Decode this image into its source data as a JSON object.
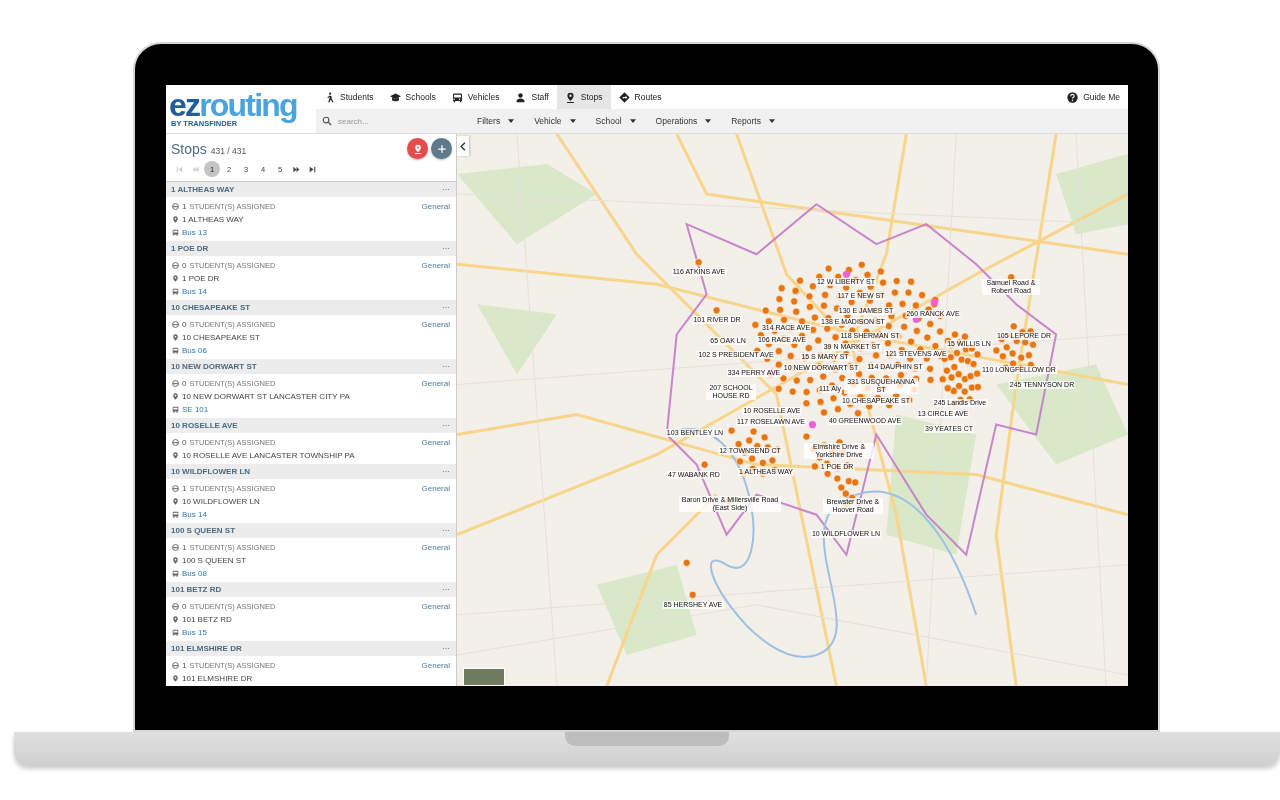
{
  "logo": {
    "part_1": "ez",
    "part_2": "routing",
    "tagline": "BY TRANSFINDER"
  },
  "tabs": [
    {
      "label": "Students",
      "selected": false
    },
    {
      "label": "Schools",
      "selected": false
    },
    {
      "label": "Vehicles",
      "selected": false
    },
    {
      "label": "Staff",
      "selected": false
    },
    {
      "label": "Stops",
      "selected": true
    },
    {
      "label": "Routes",
      "selected": false
    }
  ],
  "guide": {
    "label": "Guide Me"
  },
  "search": {
    "placeholder": "search..."
  },
  "menus": [
    "Filters",
    "Vehicle",
    "School",
    "Operations",
    "Reports"
  ],
  "panel": {
    "title": "Stops",
    "count": "431 / 431"
  },
  "pager": {
    "controls": [
      {
        "kind": "first",
        "disabled": true
      },
      {
        "kind": "prev",
        "disabled": true
      },
      {
        "kind": "next",
        "disabled": false
      },
      {
        "kind": "last",
        "disabled": false
      }
    ],
    "pages": [
      {
        "label": "1",
        "selected": true
      },
      {
        "label": "2",
        "selected": false
      },
      {
        "label": "3",
        "selected": false
      },
      {
        "label": "4",
        "selected": false
      },
      {
        "label": "5",
        "selected": false
      }
    ]
  },
  "stops": [
    {
      "name": "1 ALTHEAS WAY",
      "more": "···",
      "students": "1",
      "students_label": "STUDENT(S) ASSIGNED",
      "type": "General",
      "address": "1 ALTHEAS WAY",
      "bus": "Bus 13"
    },
    {
      "name": "1 POE DR",
      "more": "···",
      "students": "0",
      "students_label": "STUDENT(S) ASSIGNED",
      "type": "General",
      "address": "1 POE DR",
      "bus": "Bus 14"
    },
    {
      "name": "10 CHESAPEAKE ST",
      "more": "···",
      "students": "0",
      "students_label": "STUDENT(S) ASSIGNED",
      "type": "General",
      "address": "10 CHESAPEAKE ST",
      "bus": "Bus 06"
    },
    {
      "name": "10 NEW DORWART ST",
      "more": "···",
      "students": "0",
      "students_label": "STUDENT(S) ASSIGNED",
      "type": "General",
      "address": "10 NEW DORWART ST LANCASTER CITY PA",
      "bus": "SE 101"
    },
    {
      "name": "10 ROSELLE AVE",
      "more": "···",
      "students": "0",
      "students_label": "STUDENT(S) ASSIGNED",
      "type": "General",
      "address": "10 ROSELLE AVE LANCASTER TOWNSHIP PA"
    },
    {
      "name": "10 WILDFLOWER LN",
      "more": "···",
      "students": "1",
      "students_label": "STUDENT(S) ASSIGNED",
      "type": "General",
      "address": "10 WILDFLOWER LN",
      "bus": "Bus 14"
    },
    {
      "name": "100 S QUEEN ST",
      "more": "···",
      "students": "1",
      "students_label": "STUDENT(S) ASSIGNED",
      "type": "General",
      "address": "100 S QUEEN ST",
      "bus": "Bus 08"
    },
    {
      "name": "101 BETZ RD",
      "more": "···",
      "students": "0",
      "students_label": "STUDENT(S) ASSIGNED",
      "type": "General",
      "address": "101 BETZ RD",
      "bus": "Bus 15"
    },
    {
      "name": "101 ELMSHIRE DR",
      "more": "···",
      "students": "1",
      "students_label": "STUDENT(S) ASSIGNED",
      "type": "General",
      "address": "101 ELMSHIRE DR"
    }
  ],
  "map_labels": [
    "116 ATKINS AVE",
    "12 W LIBERTY ST",
    "117 E NEW ST",
    "130 E JAMES ST",
    "138 E MADISON ST",
    "260 RANCK AVE",
    "Samuel Road & Robert Road",
    "101 RIVER DR",
    "314 RACE AVE",
    "118 SHERMAN ST",
    "105 LEPORE DR",
    "65 OAK LN",
    "106 RACE AVE",
    "39 N MARKET ST",
    "15 WILLIS LN",
    "102 S PRESIDENT AVE",
    "15 S MARY ST",
    "121 STEVENS AVE",
    "110 LONGFELLOW DR",
    "334 PERRY AVE",
    "10 NEW DORWART ST",
    "114 DAUPHIN ST",
    "245 TENNYSON DR",
    "207 SCHOOL HOUSE RD",
    "111 Aly",
    "331 SUSQUEHANNA ST",
    "10 CHESAPEAKE ST",
    "245 Landis Drive",
    "10 ROSELLE AVE",
    "13 CIRCLE AVE",
    "117 ROSELAWN AVE",
    "40 GREENWOOD AVE",
    "39 YEATES CT",
    "103 BENTLEY LN",
    "12 TOWNSEND CT",
    "Elmshire Drive & Yorkshire Drive",
    "1 POE DR",
    "47 WABANK RD",
    "1 ALTHEAS WAY",
    "Baron Drive & Millersville Road (East Side)",
    "Brewster Drive & Hoover Road",
    "10 WILDFLOWER LN",
    "85 HERSHEY AVE"
  ]
}
